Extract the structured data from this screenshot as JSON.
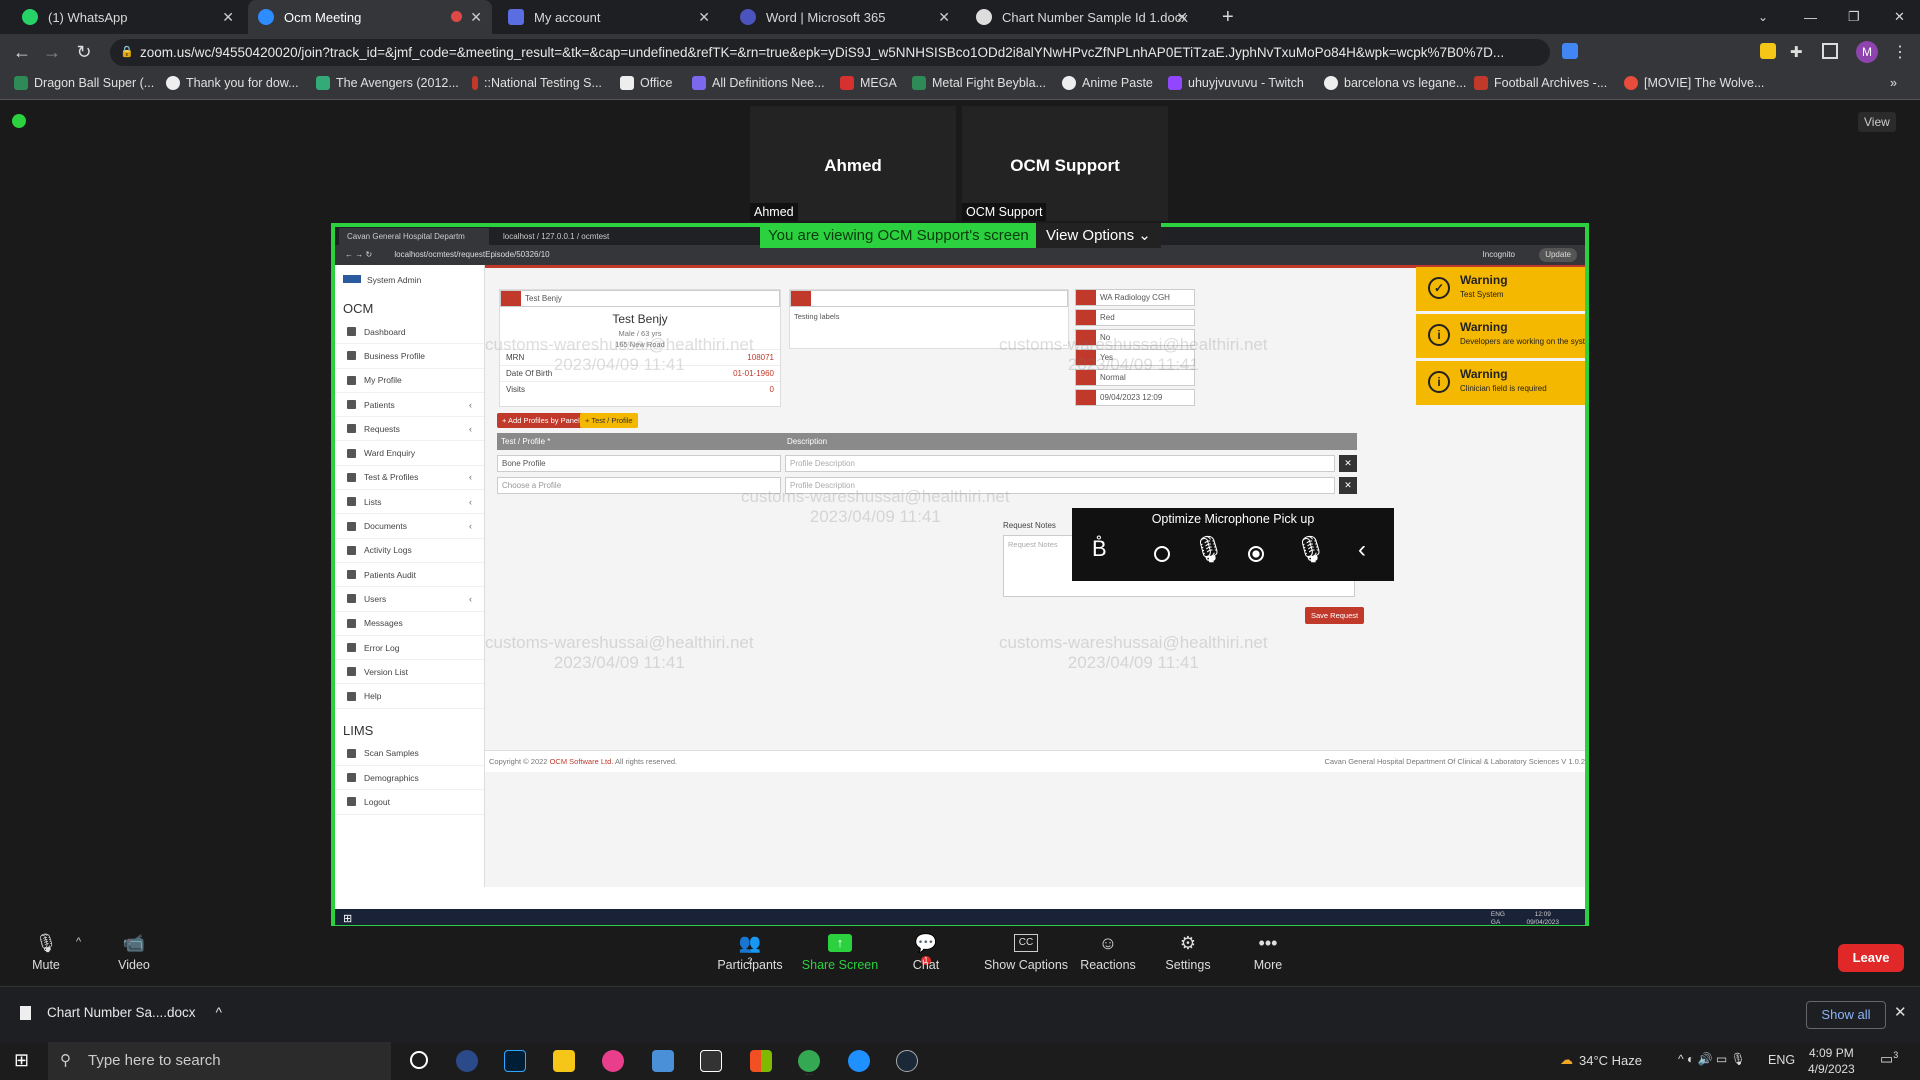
{
  "chrome": {
    "tabs": [
      {
        "title": "(1) WhatsApp"
      },
      {
        "title": "Ocm Meeting"
      },
      {
        "title": "My account"
      },
      {
        "title": "Word | Microsoft 365"
      },
      {
        "title": "Chart Number Sample Id 1.docx"
      }
    ],
    "url": "zoom.us/wc/94550420020/join?track_id=&jmf_code=&meeting_result=&tk=&cap=undefined&refTK=&rn=true&epk=yDiS9J_w5NNHSISBco1ODd2i8alYNwHPvcZfNPLnhAP0ETiTzaE.JyphNvTxuMoPo84H&wpk=wcpk%7B0%7D...",
    "bookmarks": [
      "Dragon Ball Super (...",
      "Thank you for dow...",
      "The Avengers (2012...",
      "::National Testing S...",
      "Office",
      "All Definitions Nee...",
      "MEGA",
      "Metal Fight Beybla...",
      "Anime Paste",
      "uhuyjvuvuvu - Twitch",
      "barcelona vs legane...",
      "Football Archives -...",
      "[MOVIE] The Wolve..."
    ]
  },
  "zoom": {
    "participants": [
      {
        "name": "Ahmed",
        "label": "Ahmed"
      },
      {
        "name": "OCM Support",
        "label": "OCM Support"
      }
    ],
    "view_label": "View",
    "banner": "You are viewing OCM Support's screen",
    "view_options": "View Options",
    "toolbar": {
      "mute": "Mute",
      "video": "Video",
      "participants": "Participants",
      "participants_count": "2",
      "share": "Share Screen",
      "chat": "Chat",
      "chat_badge": "1",
      "captions": "Show Captions",
      "reactions": "Reactions",
      "settings": "Settings",
      "more": "More",
      "leave": "Leave"
    },
    "mic_popup": {
      "title": "Optimize Microphone Pick up"
    }
  },
  "shared": {
    "tabs": [
      "Cavan General Hospital Departm",
      "localhost / 127.0.0.1 / ocmtest"
    ],
    "url": "localhost/ocmtest/requestEpisode/50326/10",
    "incognito": "Incognito",
    "update": "Update",
    "sidebar": {
      "user": "System Admin",
      "ocm_header": "OCM",
      "items": [
        "Dashboard",
        "Business Profile",
        "My Profile",
        "Patients",
        "Requests",
        "Ward Enquiry",
        "Test & Profiles",
        "Lists",
        "Documents",
        "Activity Logs",
        "Patients Audit",
        "Users",
        "Messages",
        "Error Log",
        "Version List",
        "Help"
      ],
      "lims_header": "LIMS",
      "lims_items": [
        "Scan Samples",
        "Demographics",
        "Logout"
      ]
    },
    "patient": {
      "select": "Test Benjy",
      "name": "Test Benjy",
      "info": "Male / 63 yrs",
      "address": "165 New Road",
      "mrn_label": "MRN",
      "mrn": "108071",
      "dob_label": "Date Of Birth",
      "dob": "01-01-1960",
      "visits_label": "Visits",
      "visits": "0"
    },
    "labels_text": "Testing labels",
    "right_fields": [
      "WA Radiology CGH",
      "Red",
      "No",
      "Yes",
      "Normal",
      "09/04/2023 12:09"
    ],
    "buttons": {
      "add_profiles": "+ Add Profiles by Panels",
      "test_profile": "+ Test / Profile",
      "save": "Save Request"
    },
    "table": {
      "col1": "Test / Profile *",
      "col2": "Description",
      "rows": [
        {
          "profile": "Bone Profile",
          "desc": "Profile Description"
        },
        {
          "profile": "Choose a Profile",
          "desc": "Profile Description"
        }
      ]
    },
    "notes_label": "Request Notes",
    "notes_placeholder": "Request Notes",
    "watermark": "customs-wareshussai@healthiri.net",
    "watermark_date": "2023/04/09 11:41",
    "footer_left": "Copyright © 2022",
    "footer_company": "OCM Software Ltd.",
    "footer_rights": "All rights reserved.",
    "footer_right": "Cavan General Hospital Department Of Clinical & Laboratory Sciences V 1.0.2",
    "warnings": [
      {
        "title": "Warning",
        "msg": "Test System"
      },
      {
        "title": "Warning",
        "msg": "Developers are working on the system."
      },
      {
        "title": "Warning",
        "msg": "Clinician field is required"
      }
    ],
    "win_tray": {
      "lang": "ENG",
      "lang2": "GA",
      "time": "12:09",
      "date": "09/04/2023"
    }
  },
  "download": {
    "file": "Chart Number Sa....docx",
    "show_all": "Show all"
  },
  "taskbar": {
    "search": "Type here to search",
    "weather": "34°C Haze",
    "lang": "ENG",
    "time": "4:09 PM",
    "date": "4/9/2023",
    "notif": "3"
  }
}
